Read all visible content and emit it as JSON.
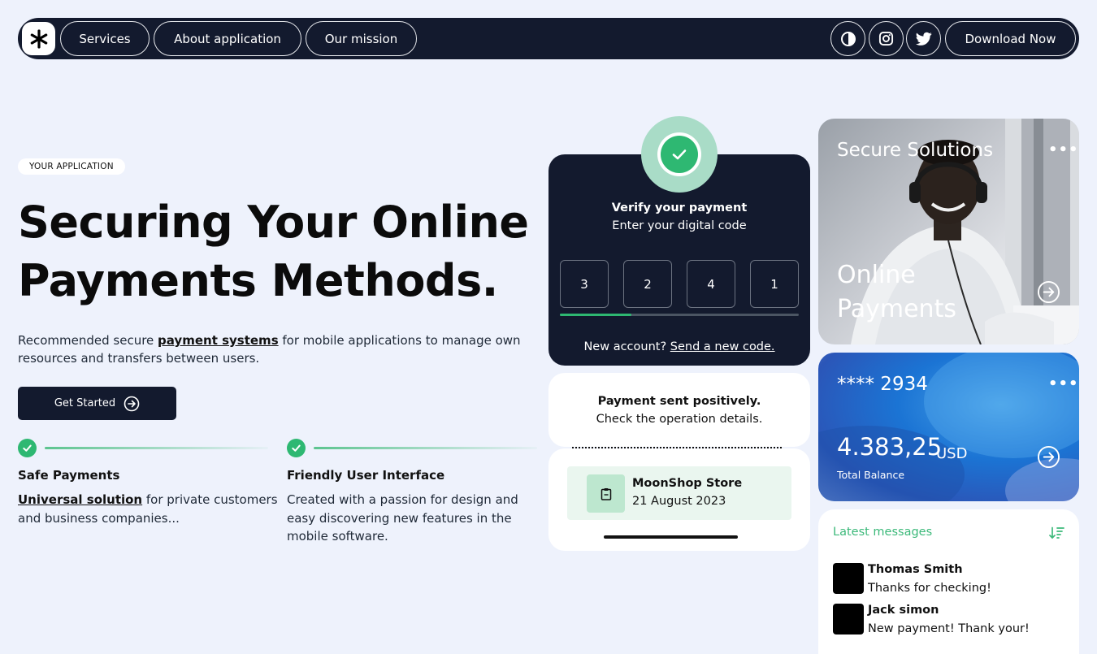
{
  "nav": {
    "items": [
      "Services",
      "About application",
      "Our mission"
    ],
    "download_label": "Download Now",
    "icons": [
      "contrast-icon",
      "instagram-icon",
      "twitter-icon"
    ]
  },
  "hero": {
    "tag": "YOUR APPLICATION",
    "title_line1": "Securing Your Online",
    "title_line2": "Payments Methods.",
    "desc_pre": "Recommended secure ",
    "desc_link": "payment systems",
    "desc_post": " for mobile applications to manage own resources and transfers between users.",
    "cta_label": "Get Started"
  },
  "features": [
    {
      "title": "Safe Payments",
      "link": "Universal solution",
      "text": " for private customers and business companies..."
    },
    {
      "title": "Friendly User Interface",
      "text": "Created with a passion for design and easy discovering new features in the mobile software."
    }
  ],
  "verify": {
    "title": "Verify your payment",
    "subtitle": "Enter your digital code",
    "digits": [
      "3",
      "2",
      "4",
      "1"
    ],
    "progress": 0.3,
    "new_account": "New account?",
    "send_code": "Send a new code."
  },
  "payment": {
    "title": "Payment sent positively.",
    "subtitle": "Check the operation details."
  },
  "store": {
    "name": "MoonShop Store",
    "date": "21 August 2023"
  },
  "photo_card": {
    "title": "Secure Solutions",
    "big_line1": "Online",
    "big_line2": "Payments"
  },
  "balance": {
    "card": "**** 2934",
    "amount": "4.383,25",
    "currency": "USD",
    "label": "Total Balance"
  },
  "messages": {
    "title": "Latest messages",
    "items": [
      {
        "name": "Thomas Smith",
        "text": "Thanks for checking!"
      },
      {
        "name": "Jack simon",
        "text": "New payment! Thank your!"
      }
    ]
  },
  "colors": {
    "navy": "#131a2e",
    "green": "#2eb872",
    "background": "#eef2fc"
  }
}
